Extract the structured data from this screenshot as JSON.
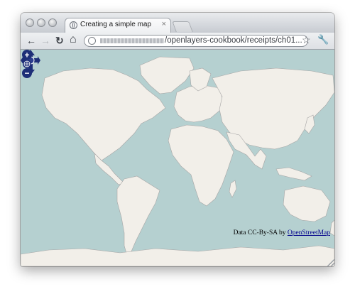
{
  "browser": {
    "tab_title": "Creating a simple map",
    "tab_close": "×",
    "url": "/openlayers-cookbook/receipts/ch01...",
    "nav": {
      "back_icon": "←",
      "forward_icon": "→",
      "reload_icon": "↻",
      "home_icon": "⌂",
      "star_icon": "☆",
      "wrench_icon": "🔧"
    }
  },
  "map": {
    "attribution_text": "Data CC-By-SA by ",
    "attribution_link": "OpenStreetMap",
    "zoom_in_label": "+",
    "zoom_out_label": "−",
    "colors": {
      "ocean": "#b5d0d0",
      "land": "#f2efe9",
      "borders": "#a7a6a6",
      "controls": "#1e2f78"
    }
  }
}
